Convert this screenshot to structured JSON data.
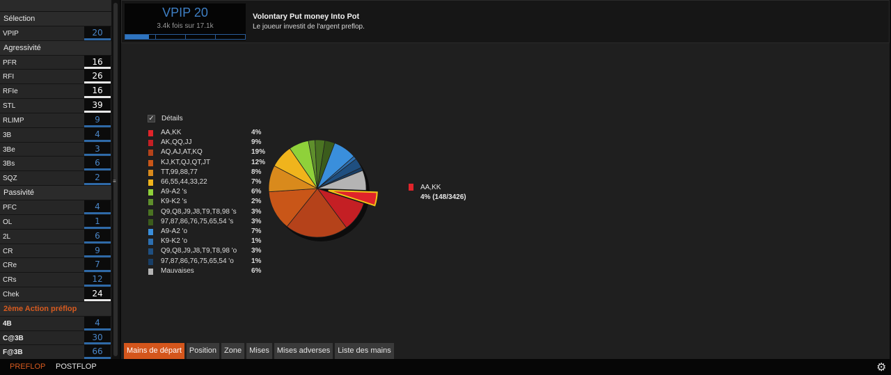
{
  "sidebar": {
    "sections": [
      {
        "title": "Sélection",
        "style": "normal",
        "rows": [
          {
            "label": "VPIP",
            "value": "20",
            "color": "blue",
            "bold": false
          }
        ]
      },
      {
        "title": "Agressivité",
        "style": "normal",
        "rows": [
          {
            "label": "PFR",
            "value": "16",
            "color": "white",
            "bold": false
          },
          {
            "label": "RFI",
            "value": "26",
            "color": "white",
            "bold": false
          },
          {
            "label": "RFIe",
            "value": "16",
            "color": "white",
            "bold": false
          },
          {
            "label": "STL",
            "value": "39",
            "color": "white",
            "bold": false
          },
          {
            "label": "RLIMP",
            "value": "9",
            "color": "blue",
            "bold": false
          },
          {
            "label": "3B",
            "value": "4",
            "color": "blue",
            "bold": false
          },
          {
            "label": "3Be",
            "value": "3",
            "color": "blue",
            "bold": false
          },
          {
            "label": "3Bs",
            "value": "6",
            "color": "blue",
            "bold": false
          },
          {
            "label": "SQZ",
            "value": "2",
            "color": "blue",
            "bold": false
          }
        ]
      },
      {
        "title": "Passivité",
        "style": "normal",
        "rows": [
          {
            "label": "PFC",
            "value": "4",
            "color": "blue",
            "bold": false
          },
          {
            "label": "OL",
            "value": "1",
            "color": "blue",
            "bold": false
          },
          {
            "label": "2L",
            "value": "6",
            "color": "blue",
            "bold": false
          },
          {
            "label": "CR",
            "value": "9",
            "color": "blue",
            "bold": false
          },
          {
            "label": "CRe",
            "value": "7",
            "color": "blue",
            "bold": false
          },
          {
            "label": "CRs",
            "value": "12",
            "color": "blue",
            "bold": false
          },
          {
            "label": "Chek",
            "value": "24",
            "color": "white",
            "bold": false
          }
        ]
      },
      {
        "title": "2ème Action préflop",
        "style": "orange",
        "rows": [
          {
            "label": "4B",
            "value": "4",
            "color": "blue",
            "bold": true
          },
          {
            "label": "C@3B",
            "value": "30",
            "color": "blue",
            "bold": true
          },
          {
            "label": "F@3B",
            "value": "66",
            "color": "blue",
            "bold": true
          }
        ]
      }
    ]
  },
  "stat": {
    "title": "VPIP 20",
    "subtitle": "3.4k fois sur 17.1k",
    "progress": 0.2,
    "name": "Volontary Put money Into Pot",
    "description": "Le joueur investit de l'argent preflop."
  },
  "details": {
    "label": "Détails",
    "checked": true,
    "check_glyph": "✓"
  },
  "chart_data": {
    "type": "pie",
    "title": "",
    "slices": [
      {
        "name": "AA,KK",
        "percent_label": "4%",
        "value": 4,
        "color": "#e0242a"
      },
      {
        "name": "AK,QQ,JJ",
        "percent_label": "9%",
        "value": 9,
        "color": "#c41f24"
      },
      {
        "name": "AQ,AJ,AT,KQ",
        "percent_label": "19%",
        "value": 19,
        "color": "#b5421a"
      },
      {
        "name": "KJ,KT,QJ,QT,JT",
        "percent_label": "12%",
        "value": 12,
        "color": "#c95618"
      },
      {
        "name": "TT,99,88,77",
        "percent_label": "8%",
        "value": 8,
        "color": "#d98a1c"
      },
      {
        "name": "66,55,44,33,22",
        "percent_label": "7%",
        "value": 7,
        "color": "#f0b41c"
      },
      {
        "name": "A9-A2 's",
        "percent_label": "6%",
        "value": 6,
        "color": "#8fd13a"
      },
      {
        "name": "K9-K2 's",
        "percent_label": "2%",
        "value": 2,
        "color": "#5f8f2c"
      },
      {
        "name": "Q9,Q8,J9,J8,T9,T8,98 's",
        "percent_label": "3%",
        "value": 3,
        "color": "#4a7322"
      },
      {
        "name": "97,87,86,76,75,65,54 's",
        "percent_label": "3%",
        "value": 3,
        "color": "#3b5c1c"
      },
      {
        "name": "A9-A2 'o",
        "percent_label": "7%",
        "value": 7,
        "color": "#3a8fdc"
      },
      {
        "name": "K9-K2 'o",
        "percent_label": "1%",
        "value": 1,
        "color": "#2d6fb0"
      },
      {
        "name": "Q9,Q8,J9,J8,T9,T8,98 'o",
        "percent_label": "3%",
        "value": 3,
        "color": "#1f4f80"
      },
      {
        "name": "97,87,86,76,75,65,54 'o",
        "percent_label": "1%",
        "value": 1,
        "color": "#183e66"
      },
      {
        "name": "Mauvaises",
        "percent_label": "6%",
        "value": 6,
        "color": "#b4b4b4"
      }
    ],
    "highlighted": {
      "name": "AA,KK",
      "detail": "4% (148/3426)",
      "color": "#e0242a"
    }
  },
  "tabs": [
    {
      "label": "Mains de départ",
      "active": true
    },
    {
      "label": "Position",
      "active": false
    },
    {
      "label": "Zone",
      "active": false
    },
    {
      "label": "Mises",
      "active": false
    },
    {
      "label": "Mises adverses",
      "active": false
    },
    {
      "label": "Liste des mains",
      "active": false
    }
  ],
  "bottom": {
    "preflop": "PREFLOP",
    "postflop": "POSTFLOP",
    "settings_icon": "gear-icon",
    "settings_glyph": "⚙"
  },
  "splitter": {
    "glyph": "≡"
  }
}
